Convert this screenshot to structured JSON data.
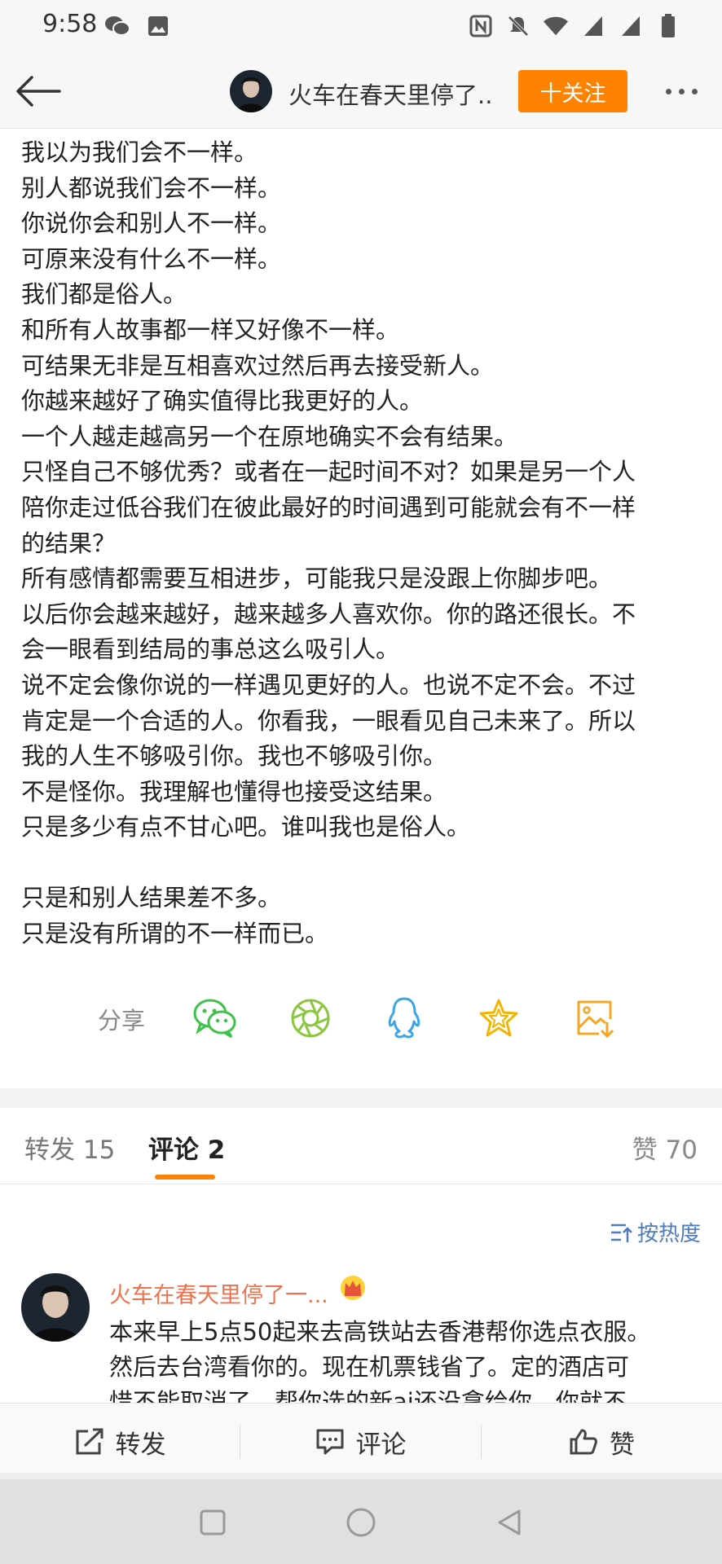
{
  "status_bar": {
    "time": "9:58",
    "left_icons": [
      "wechat-icon",
      "gallery-icon"
    ],
    "right_icons": [
      "nfc-icon",
      "mute-icon",
      "wifi-icon",
      "signal-icon",
      "signal-icon",
      "battery-icon"
    ]
  },
  "header": {
    "title": "火车在春天里停了...",
    "follow_label": "十关注"
  },
  "post": {
    "lines": [
      "我以为我们会不一样。",
      "别人都说我们会不一样。",
      "你说你会和别人不一样。",
      "可原来没有什么不一样。",
      "我们都是俗人。",
      "和所有人故事都一样又好像不一样。",
      "可结果无非是互相喜欢过然后再去接受新人。",
      "你越来越好了确实值得比我更好的人。",
      "一个人越走越高另一个在原地确实不会有结果。",
      "只怪自己不够优秀？或者在一起时间不对？如果是另一个人",
      "陪你走过低谷我们在彼此最好的时间遇到可能就会有不一样",
      "的结果？",
      "所有感情都需要互相进步，可能我只是没跟上你脚步吧。",
      "以后你会越来越好，越来越多人喜欢你。你的路还很长。不",
      "会一眼看到结局的事总这么吸引人。",
      "说不定会像你说的一样遇见更好的人。也说不定不会。不过",
      "肯定是一个合适的人。你看我，一眼看见自己未来了。所以",
      "我的人生不够吸引你。我也不够吸引你。",
      "不是怪你。我理解也懂得也接受这结果。",
      "只是多少有点不甘心吧。谁叫我也是俗人。"
    ],
    "lines_after_break": [
      "只是和别人结果差不多。",
      "只是没有所谓的不一样而已。"
    ]
  },
  "share": {
    "label": "分享",
    "targets": [
      "wechat-icon",
      "moments-icon",
      "qq-icon",
      "favorite-star-icon",
      "save-image-icon"
    ],
    "colors": {
      "wechat": "#3ec24b",
      "moments": "#8cc63f",
      "qq": "#3aa6e8",
      "star": "#f5b400",
      "save": "#f5a623"
    }
  },
  "tabs": {
    "repost": "转发 15",
    "comment": "评论 2",
    "like": "赞 70"
  },
  "sort": {
    "label": "按热度"
  },
  "comment": {
    "name": "火车在春天里停了一...",
    "lines": [
      "本来早上5点50起来去高铁站去香港帮你选点衣服。",
      "然后去台湾看你的。现在机票钱省了。定的酒店可",
      "惜不能取消了。帮你选的新ai还没拿给你。你就不"
    ]
  },
  "actions": {
    "repost": "转发",
    "comment": "评论",
    "like": "赞"
  },
  "colors": {
    "accent": "#ff8200",
    "name_link": "#eb7350",
    "sort_link": "#4d7cbf"
  }
}
